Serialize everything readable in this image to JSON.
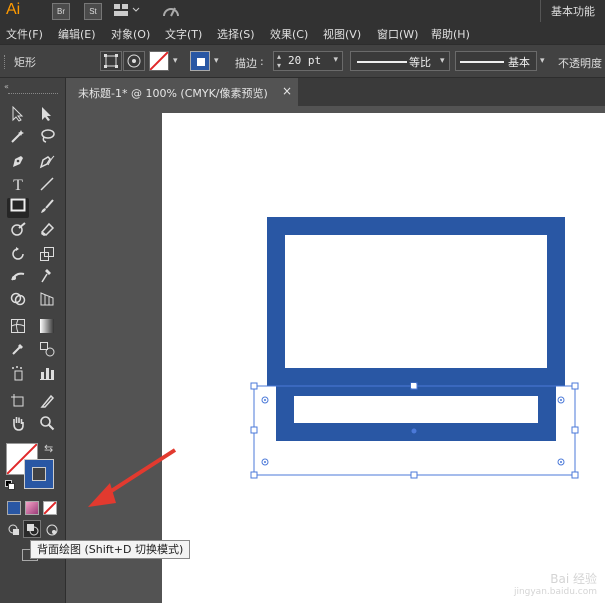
{
  "app": {
    "logo": "Ai",
    "bridge_label": "Br",
    "stock_label": "St",
    "workspace": "基本功能"
  },
  "menu": {
    "items": [
      "文件(F)",
      "编辑(E)",
      "对象(O)",
      "文字(T)",
      "选择(S)",
      "效果(C)",
      "视图(V)",
      "窗口(W)",
      "帮助(H)"
    ]
  },
  "control_bar": {
    "selection_type": "矩形",
    "stroke_label": "描边",
    "stroke_width": "20 pt",
    "profile_label": "等比",
    "brush_label": "基本",
    "opacity_label": "不透明度"
  },
  "document": {
    "tab_title": "未标题-1* @ 100% (CMYK/像素预览)",
    "close_glyph": "×"
  },
  "tooltip": {
    "text": "背面绘图 (Shift+D 切换模式)"
  },
  "watermark": {
    "line1": "Bai 经验",
    "line2": "jingyan.baidu.com"
  },
  "colors": {
    "stroke_blue": "#2957a4",
    "selection": "#3d6fd6",
    "arrow_red": "#e23a2f"
  }
}
